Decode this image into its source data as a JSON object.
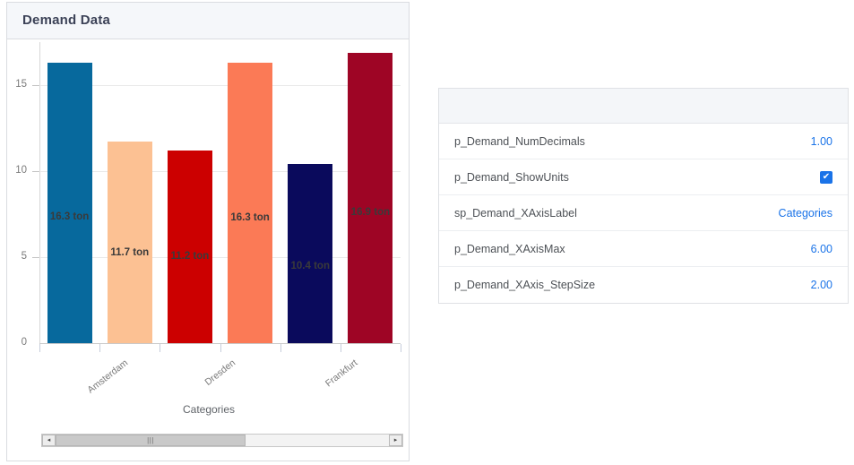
{
  "chart_panel": {
    "title": "Demand Data",
    "x_axis_title": "Categories"
  },
  "chart_data": {
    "type": "bar",
    "title": "Demand Data",
    "xlabel": "Categories",
    "ylabel": "",
    "ylim": [
      0,
      17.5
    ],
    "yticks": [
      0,
      5,
      10,
      15
    ],
    "ytick_labels": [
      "0",
      "5",
      "10",
      "15"
    ],
    "grid": true,
    "legend": "none",
    "unit": "ton",
    "categories": [
      "Amsterdam",
      "",
      "Dresden",
      "",
      "Frankfurt",
      ""
    ],
    "xtick_labels_shown": [
      "Amsterdam",
      "Dresden",
      "Frankfurt"
    ],
    "values": [
      16.3,
      11.7,
      11.2,
      16.3,
      10.4,
      16.9
    ],
    "data_labels": [
      "16.3 ton",
      "11.7 ton",
      "11.2 ton",
      "16.3 ton",
      "10.4 ton",
      "16.9 ton"
    ],
    "colors": [
      "#07699d",
      "#fcc193",
      "#cc0000",
      "#fb7a56",
      "#0a0a5c",
      "#9e0525"
    ]
  },
  "scrollbar": {
    "left_arrow": "◂",
    "right_arrow": "▸",
    "grip": "|||"
  },
  "table": {
    "header_label": "",
    "rows": [
      {
        "key": "p_Demand_NumDecimals",
        "value": "1.00",
        "type": "number"
      },
      {
        "key": "p_Demand_ShowUnits",
        "value": "✔",
        "type": "checkbox",
        "checked": true
      },
      {
        "key": "sp_Demand_XAxisLabel",
        "value": "Categories",
        "type": "text"
      },
      {
        "key": "p_Demand_XAxisMax",
        "value": "6.00",
        "type": "number"
      },
      {
        "key": "p_Demand_XAxis_StepSize",
        "value": "2.00",
        "type": "number"
      }
    ]
  },
  "colors": {
    "accent": "#1a73e8",
    "panel_header": "#f5f7fa",
    "border": "#dadce0",
    "title_text": "#3c4257"
  }
}
